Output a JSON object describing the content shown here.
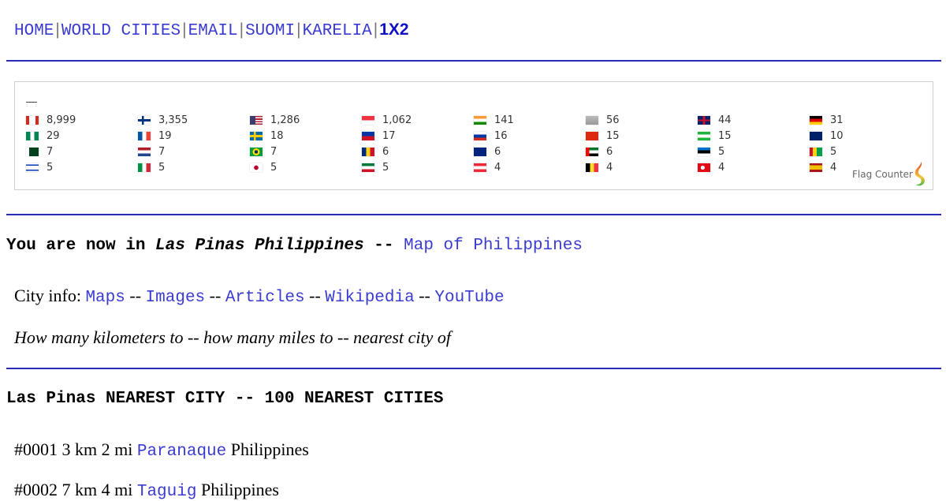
{
  "nav": {
    "items": [
      {
        "label": "HOME"
      },
      {
        "label": "WORLD CITIES"
      },
      {
        "label": "EMAIL"
      },
      {
        "label": "SUOMI"
      },
      {
        "label": "KARELIA"
      }
    ],
    "active": "1X2",
    "separator": "|"
  },
  "flag_counter": {
    "logo_text": "Flag Counter",
    "columns": [
      [
        {
          "country": "Canada",
          "icon": "flag-ca",
          "count": "8,999"
        },
        {
          "country": "Nigeria",
          "icon": "flag-ng",
          "count": "29"
        },
        {
          "country": "Pakistan",
          "icon": "flag-pk",
          "count": "7"
        },
        {
          "country": "Israel",
          "icon": "flag-il",
          "count": "5"
        }
      ],
      [
        {
          "country": "Finland",
          "icon": "flag-fi",
          "count": "3,355"
        },
        {
          "country": "France",
          "icon": "flag-fr",
          "count": "19"
        },
        {
          "country": "Netherlands",
          "icon": "flag-nl",
          "count": "7"
        },
        {
          "country": "Italy",
          "icon": "flag-it",
          "count": "5"
        }
      ],
      [
        {
          "country": "United States",
          "icon": "flag-us",
          "count": "1,286"
        },
        {
          "country": "Sweden",
          "icon": "flag-se",
          "count": "18"
        },
        {
          "country": "Brazil",
          "icon": "flag-br",
          "count": "7"
        },
        {
          "country": "Japan",
          "icon": "flag-jp",
          "count": "5"
        }
      ],
      [
        {
          "country": "Singapore",
          "icon": "flag-sg",
          "count": "1,062"
        },
        {
          "country": "Philippines",
          "icon": "flag-ph",
          "count": "17"
        },
        {
          "country": "Romania",
          "icon": "flag-ro",
          "count": "6"
        },
        {
          "country": "Kuwait",
          "icon": "flag-kw",
          "count": "5"
        }
      ],
      [
        {
          "country": "India",
          "icon": "flag-in",
          "count": "141"
        },
        {
          "country": "Russia",
          "icon": "flag-ru",
          "count": "16"
        },
        {
          "country": "New Zealand",
          "icon": "flag-nz",
          "count": "6"
        },
        {
          "country": "Austria",
          "icon": "flag-at",
          "count": "4"
        }
      ],
      [
        {
          "country": "Unknown",
          "icon": "flag-unknown",
          "count": "56"
        },
        {
          "country": "China",
          "icon": "flag-cn",
          "count": "15"
        },
        {
          "country": "United Arab Emirates",
          "icon": "flag-ae",
          "count": "6"
        },
        {
          "country": "Belgium",
          "icon": "flag-be",
          "count": "4"
        }
      ],
      [
        {
          "country": "United Kingdom",
          "icon": "flag-gb",
          "count": "44"
        },
        {
          "country": "Uzbekistan",
          "icon": "flag-uz",
          "count": "15"
        },
        {
          "country": "Estonia",
          "icon": "flag-ee",
          "count": "5"
        },
        {
          "country": "Turkey",
          "icon": "flag-tr",
          "count": "4"
        }
      ],
      [
        {
          "country": "Germany",
          "icon": "flag-de",
          "count": "31"
        },
        {
          "country": "Australia",
          "icon": "flag-au",
          "count": "10"
        },
        {
          "country": "Guyana",
          "icon": "flag-gy",
          "count": "5"
        },
        {
          "country": "Spain",
          "icon": "flag-es",
          "count": "4"
        }
      ]
    ]
  },
  "location": {
    "prefix": "You are now in ",
    "place": "Las Pinas Philippines",
    "dashes": " -- ",
    "map_link": "Map of Philippines"
  },
  "city_info": {
    "label": "City info: ",
    "links": [
      "Maps",
      "Images",
      "Articles",
      "Wikipedia",
      "YouTube"
    ],
    "sep": " -- "
  },
  "how_many": "How many kilometers to -- how many miles to -- nearest city of",
  "nearest": {
    "title": "Las Pinas NEAREST CITY -- 100 NEAREST CITIES",
    "rows": [
      {
        "prefix": "#0001 3 km 2 mi ",
        "city": "Paranaque",
        "country": " Philippines"
      },
      {
        "prefix": "#0002 7 km 4 mi ",
        "city": "Taguig",
        "country": " Philippines"
      }
    ]
  }
}
